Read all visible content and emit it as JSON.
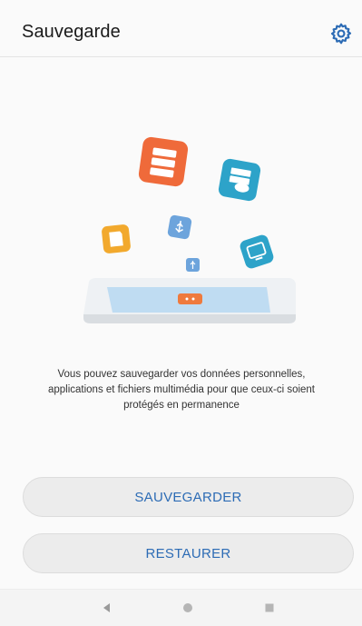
{
  "header": {
    "title": "Sauvegarde",
    "settings_icon": "gear-icon"
  },
  "illustration": {
    "icons": [
      "files-icon",
      "cloud-backup-icon",
      "sd-card-icon",
      "usb-icon",
      "usb-small-icon",
      "pc-icon",
      "phone-icon"
    ]
  },
  "description": {
    "line1": "Vous pouvez sauvegarder vos données personnelles,",
    "line2": "applications et fichiers multimédia pour que ceux-ci soient",
    "line3": "protégés en permanence"
  },
  "buttons": {
    "backup_label": "SAUVEGARDER",
    "restore_label": "RESTAURER"
  },
  "navbar": {
    "icons": [
      "back-icon",
      "home-icon",
      "recent-apps-icon"
    ]
  },
  "colors": {
    "accent": "#2d6cb5",
    "orange": "#ef6a3a",
    "teal": "#2da3c9",
    "yellow": "#f2a92d",
    "blue_light": "#6da4dc"
  }
}
